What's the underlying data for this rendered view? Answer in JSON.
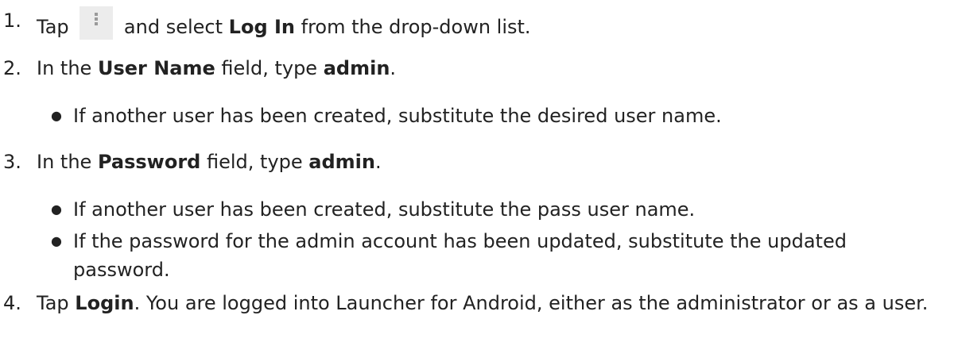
{
  "steps": [
    {
      "number": "1.",
      "before_icon": "Tap",
      "icon": "more-vert-icon",
      "after_icon": "and select",
      "bold": "Log In",
      "after_bold": "from the drop-down list."
    },
    {
      "number": "2.",
      "pre": "In the",
      "bold1": "User Name",
      "mid": "field, type",
      "bold2": "admin",
      "end": ".",
      "bullets": [
        "If another user has been created, substitute the desired user name."
      ]
    },
    {
      "number": "3.",
      "pre": "In the",
      "bold1": "Password",
      "mid": "field, type",
      "bold2": "admin",
      "end": ".",
      "bullets": [
        "If another user has been created, substitute the pass user name.",
        "If the password for the admin account has been updated, substitute the updated password."
      ]
    },
    {
      "number": "4.",
      "pre": "Tap",
      "bold": "Login",
      "post": ". You are logged into Launcher for Android, either as the administrator or as a user."
    }
  ],
  "bullet_glyph": "●"
}
